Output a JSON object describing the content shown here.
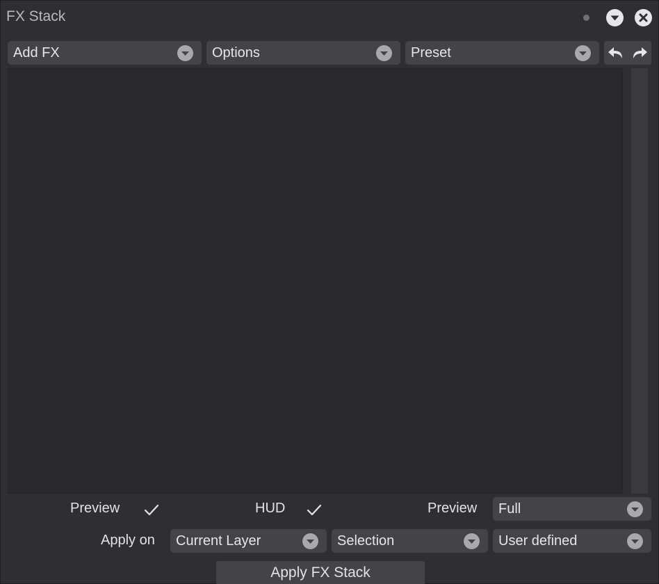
{
  "window": {
    "title": "FX Stack"
  },
  "toolbar": {
    "add_fx": "Add FX",
    "options": "Options",
    "preset": "Preset"
  },
  "bottom": {
    "preview_label": "Preview",
    "preview_checked": true,
    "hud_label": "HUD",
    "hud_checked": true,
    "preview_mode_label": "Preview",
    "preview_mode_value": "Full",
    "apply_on_label": "Apply on",
    "apply_on_value": "Current Layer",
    "selection_value": "Selection",
    "user_defined_value": "User defined",
    "apply_button": "Apply FX Stack"
  },
  "colors": {
    "background": "#2f2e32",
    "control": "#444348",
    "stack_area": "#29282c",
    "text": "#e3e3e6"
  },
  "icons": {
    "window_menu": "chevron-down-circle-icon",
    "window_close": "close-circle-icon",
    "dropdown_caret": "chevron-down-circle-icon",
    "undo": "undo-arrow-icon",
    "redo": "redo-arrow-icon",
    "check": "checkmark-icon"
  }
}
